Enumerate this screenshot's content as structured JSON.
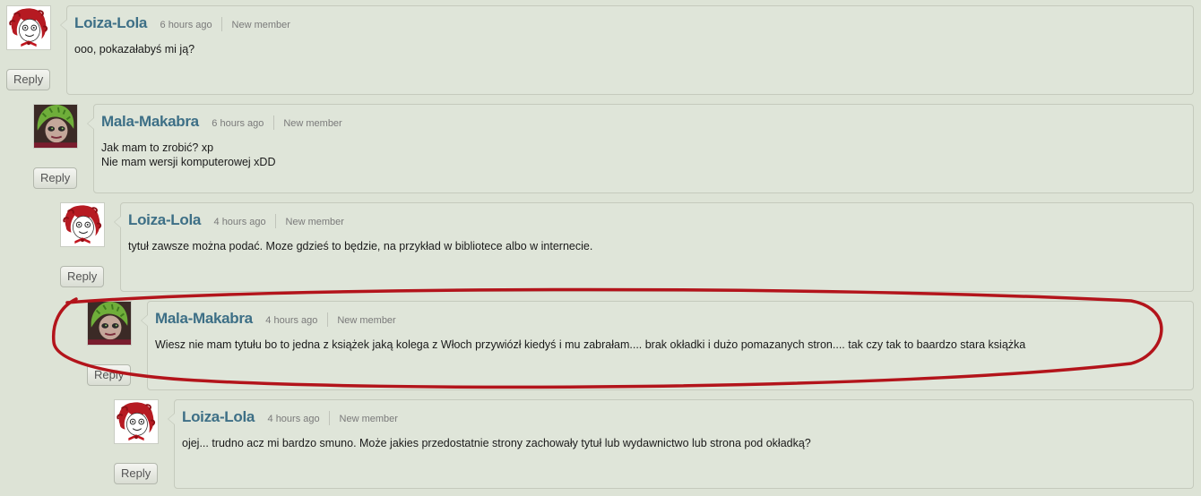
{
  "comments": [
    {
      "author": "Loiza-Lola",
      "time": "6 hours ago",
      "role": "New member",
      "lines": [
        "ooo, pokazałabyś mi ją?"
      ],
      "reply_label": "Reply",
      "avatar_icon": "red-haired-girl-doodle-avatar"
    },
    {
      "author": "Mala-Makabra",
      "time": "6 hours ago",
      "role": "New member",
      "lines": [
        "Jak mam to zrobić? xp",
        "Nie mam wersji komputerowej xDD"
      ],
      "reply_label": "Reply",
      "avatar_icon": "green-haired-doll-avatar"
    },
    {
      "author": "Loiza-Lola",
      "time": "4 hours ago",
      "role": "New member",
      "lines": [
        "tytuł zawsze można podać. Moze gdzieś to będzie, na przykład w bibliotece albo w internecie."
      ],
      "reply_label": "Reply",
      "avatar_icon": "red-haired-girl-doodle-avatar"
    },
    {
      "author": "Mala-Makabra",
      "time": "4 hours ago",
      "role": "New member",
      "lines": [
        "Wiesz nie mam tytułu bo to jedna z książek jaką kolega z Włoch przywiózł kiedyś i mu zabrałam.... brak okładki i dużo pomazanych stron.... tak czy tak to baardzo stara książka"
      ],
      "reply_label": "Reply",
      "avatar_icon": "green-haired-doll-avatar"
    },
    {
      "author": "Loiza-Lola",
      "time": "4 hours ago",
      "role": "New member",
      "lines": [
        "ojej... trudno acz mi bardzo smuno. Może jakies przedostatnie strony zachowały tytuł lub wydawnictwo lub strona pod okładką?"
      ],
      "reply_label": "Reply",
      "avatar_icon": "red-haired-girl-doodle-avatar"
    }
  ],
  "colors": {
    "page_background": "#dde3d6",
    "author_link": "#3d6f86",
    "highlight_ellipse": "#b3141b"
  }
}
